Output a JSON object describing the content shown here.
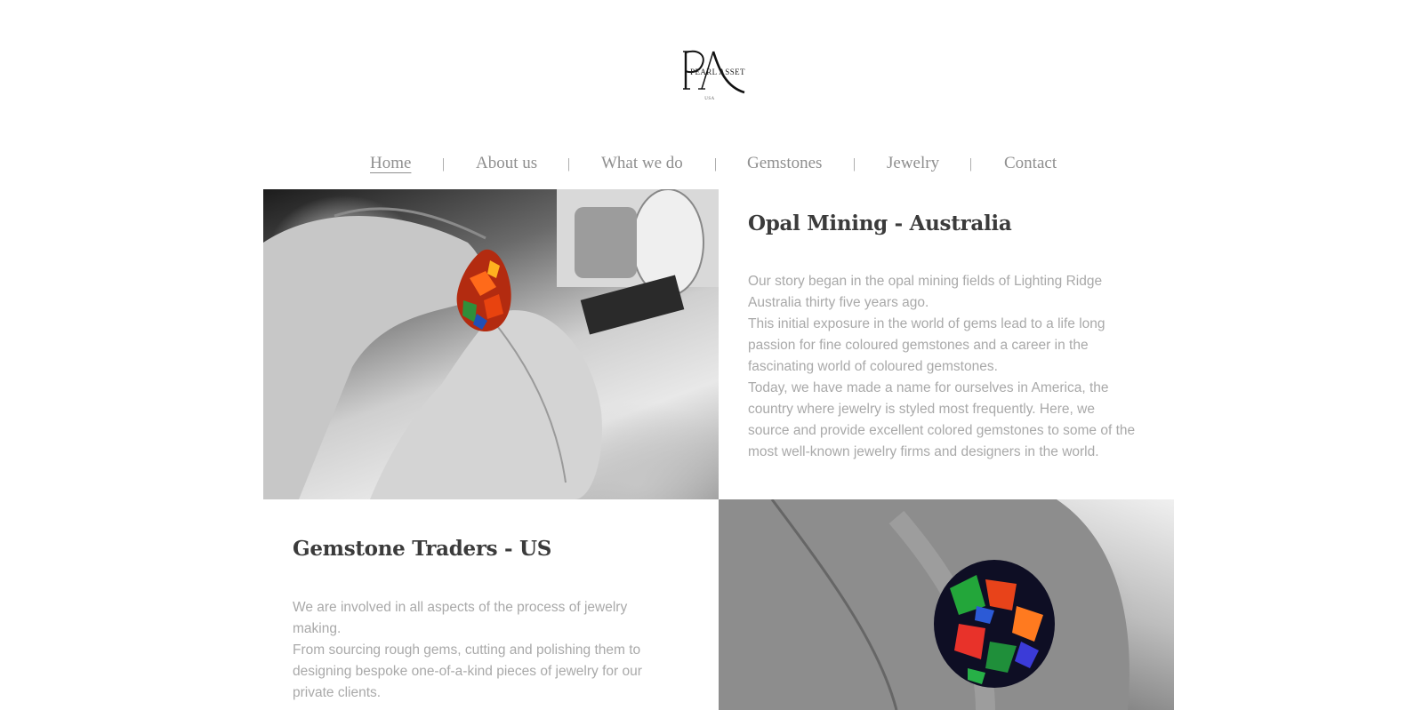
{
  "brand": {
    "logo_text": "PEARL ASSET",
    "logo_subtext": "USA"
  },
  "nav": {
    "items": [
      {
        "label": "Home",
        "active": true
      },
      {
        "label": "About us",
        "active": false
      },
      {
        "label": "What we do",
        "active": false
      },
      {
        "label": "Gemstones",
        "active": false
      },
      {
        "label": "Jewelry",
        "active": false
      },
      {
        "label": "Contact",
        "active": false
      }
    ],
    "separator": "|"
  },
  "sections": {
    "opal_mining": {
      "title": "Opal Mining - Australia",
      "paragraphs": [
        "Our story began in the opal mining fields of Lighting Ridge Australia thirty five years ago.",
        "This initial exposure in the world of gems lead to a life long passion for fine coloured gemstones and a career in the fascinating world of coloured gemstones.",
        "Today, we have made a name for ourselves in America, the country where jewelry is styled most frequently. Here, we source and provide excellent colored gemstones to some of the most well-known jewelry firms and designers in the world."
      ]
    },
    "gemstone_traders": {
      "title": "Gemstone Traders - US",
      "paragraphs": [
        "We are involved in all aspects of the process of jewelry making.",
        "From sourcing rough gems, cutting and polishing them to designing bespoke one-of-a-kind pieces of jewelry for our private clients."
      ]
    }
  },
  "colors": {
    "nav_text": "#8f8f8f",
    "title_text": "#3b3b3b",
    "body_text": "#a9a9a9",
    "background": "#ffffff"
  }
}
